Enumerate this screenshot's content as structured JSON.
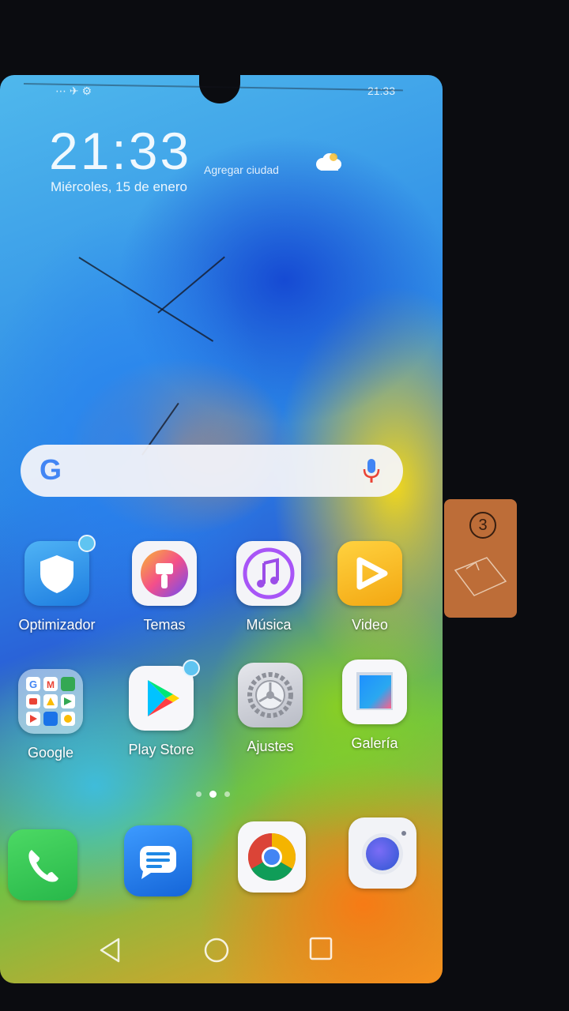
{
  "status_bar": {
    "left": "⋯ ✈ ⚙",
    "time": "21:33"
  },
  "lock_widget": {
    "time": "21:33",
    "weather_label": "Agregar ciudad",
    "date": "Miércoles, 15 de enero"
  },
  "search": {
    "logo": "G"
  },
  "apps_row1": [
    {
      "label": "Optimizador",
      "icon": "shield-icon"
    },
    {
      "label": "Temas",
      "icon": "paintbrush-icon"
    },
    {
      "label": "Música",
      "icon": "music-note-icon"
    },
    {
      "label": "Video",
      "icon": "play-icon"
    }
  ],
  "apps_row2": [
    {
      "label": "Google",
      "icon": "folder-icon"
    },
    {
      "label": "Play Store",
      "icon": "play-store-icon"
    },
    {
      "label": "Ajustes",
      "icon": "gear-icon"
    },
    {
      "label": "Galería",
      "icon": "gallery-icon"
    }
  ],
  "dock": [
    {
      "icon": "phone-icon"
    },
    {
      "icon": "messages-icon"
    },
    {
      "icon": "chrome-icon"
    },
    {
      "icon": "camera-icon"
    }
  ],
  "page_indicator": {
    "count": 3,
    "active": 1
  },
  "nav_bar": [
    "back-icon",
    "home-icon",
    "recents-icon"
  ],
  "sticker": {
    "number": "3"
  },
  "colors": {
    "badge": "#5fc4f1",
    "search_bg": "#f5f5fa",
    "phone_green": "#34c759",
    "messages_blue": "#1e88e5"
  }
}
